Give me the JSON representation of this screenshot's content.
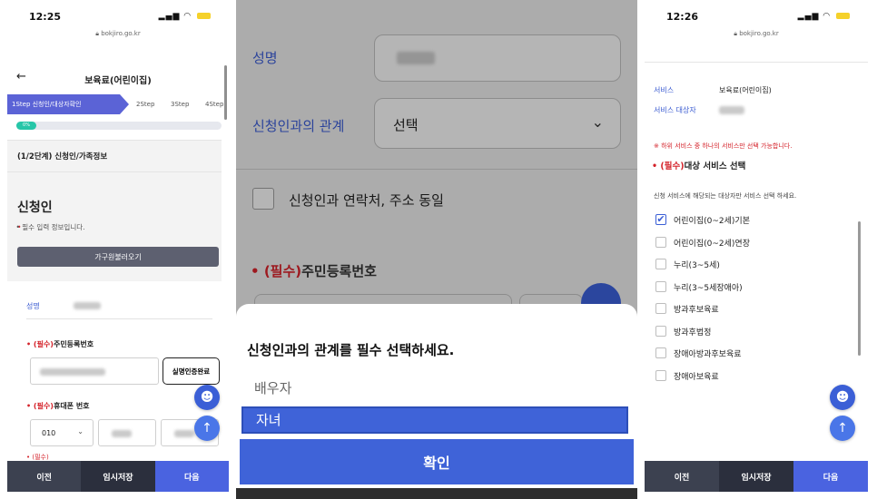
{
  "panel1": {
    "status": {
      "time": "12:25",
      "url": "bokjiro.go.kr"
    },
    "header": {
      "back": "←",
      "title": "보육료(어린이집)"
    },
    "steps": {
      "step1": "1Step 신청인/대상자확인",
      "step2": "2Step",
      "step3": "3Step",
      "step4": "4Step"
    },
    "progress": {
      "value": 0.08,
      "label": "0%"
    },
    "section_title": "(1/2단계) 신청인/가족정보",
    "applicant": {
      "heading": "신청인",
      "required_note": "• 필수 입력 정보입니다.",
      "family_button": "가구원불러오기"
    },
    "name_label": "성명",
    "rrn": {
      "bullet": "• ",
      "required": "(필수)",
      "label": "주민등록번호",
      "verify_button": "실명인증완료"
    },
    "phone": {
      "bullet": "• ",
      "required": "(필수)",
      "label": "휴대폰 번호",
      "prefix": "010",
      "chevron": "⌄"
    },
    "cutoff_text": "• (필수)",
    "chat_icon": "☻",
    "up_icon": "↑",
    "bottom": {
      "prev": "이전",
      "temp_save": "임시저장",
      "next": "다음"
    }
  },
  "panel2": {
    "name_label": "성명",
    "relation_label": "신청인과의 관계",
    "relation_value": "선택",
    "relation_chevron": "⌄",
    "same_contact_label": "신청인과 연락처, 주소 동일",
    "rrn": {
      "bullet": "• ",
      "required": "(필수)",
      "label": "주민등록번호"
    },
    "sheet": {
      "title": "신청인과의 관계를 필수 선택하세요.",
      "options": [
        "배우자",
        "자녀"
      ],
      "selected": "자녀",
      "confirm": "확인"
    }
  },
  "panel3": {
    "status": {
      "time": "12:26",
      "url": "bokjiro.go.kr"
    },
    "service_label": "서비스",
    "service_value": "보육료(어린이집)",
    "target_label": "서비스 대상자",
    "warning": "※ 하위 서비스 중 하나의 서비스만 선택 가능합니다.",
    "select_header": {
      "bullet": "• ",
      "required": "(필수)",
      "label": "대상 서비스 선택"
    },
    "guide": "신청 서비스에 해당되는 대상자만 서비스 선택 하세요.",
    "services": [
      {
        "label": "어린이집(0~2세)기본",
        "checked": true
      },
      {
        "label": "어린이집(0~2세)연장",
        "checked": false
      },
      {
        "label": "누리(3~5세)",
        "checked": false
      },
      {
        "label": "누리(3~5세장애아)",
        "checked": false
      },
      {
        "label": "방과후보육료",
        "checked": false
      },
      {
        "label": "방과후법정",
        "checked": false
      },
      {
        "label": "장애아방과후보육료",
        "checked": false
      },
      {
        "label": "장애아보육료",
        "checked": false
      }
    ],
    "check_mark": "✔",
    "chat_icon": "☻",
    "up_icon": "↑",
    "bottom": {
      "prev": "이전",
      "temp_save": "임시저장",
      "next": "다음"
    }
  },
  "colors": {
    "primary": "#3f63d8",
    "step_active": "#5b63d6",
    "required": "#d4222a",
    "label_blue": "#3a5bd1",
    "progress": "#26c6a8"
  }
}
